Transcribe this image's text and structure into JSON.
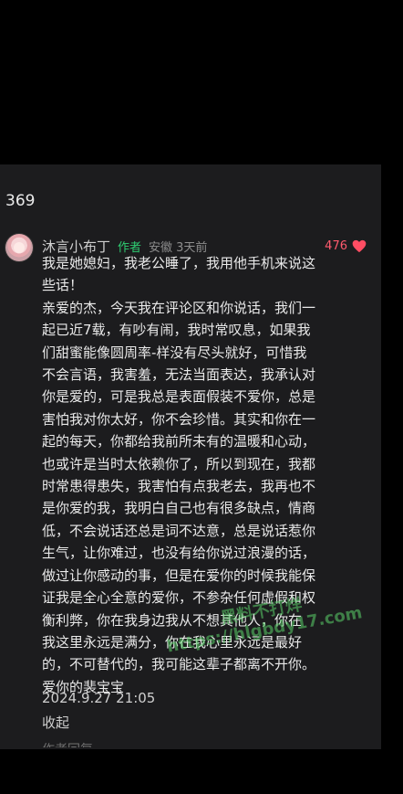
{
  "comment_count": "369",
  "comment": {
    "username": "沐言小布丁",
    "author_badge": "作者",
    "meta": "安徽 3天前",
    "likes": "476",
    "text": "我是她媳妇，我老公睡了，我用他手机来说这\n些话！\n亲爱的杰，今天我在评论区和你说话，我们一\n起已近7载，有吵有闹，我时常叹息，如果我\n们甜蜜能像圆周率-样没有尽头就好，可惜我\n不会言语，我害羞，无法当面表达，我承认对\n你是爱的，可是我总是表面假装不爱你，总是\n害怕我对你太好，你不会珍惜。其实和你在一\n起的每天，你都给我前所未有的温暖和心动，\n也或许是当时太依赖你了，所以到现在，我都\n时常患得患失，我害怕有点我老去，我再也不\n是你爱的我，我明白自己也有很多缺点，情商\n低，不会说话还总是词不达意，总是说话惹你\n生气，让你难过，也没有给你说过浪漫的话，\n做过让你感动的事，但是在爱你的时候我能保\n证我是全心全意的爱你，不参杂任何虚假和权\n衡利弊，你在我身边我从不想其他人，你在\n我这里永远是满分，你在我心里永远是最好\n的，不可替代的，我可能这辈子都离不开你。\n爱你的裴宝宝",
    "timestamp": "2024.9.27 21:05",
    "collapse_label": "收起",
    "more_hint": "作者回复"
  },
  "watermark": {
    "line1": "黑料不打烊",
    "line2": "https://hlgbdy17.com"
  },
  "colors": {
    "background": "#000000",
    "panel": "#1c1c1e",
    "author_badge": "#2ecc71",
    "likes": "#ff5a6e"
  }
}
